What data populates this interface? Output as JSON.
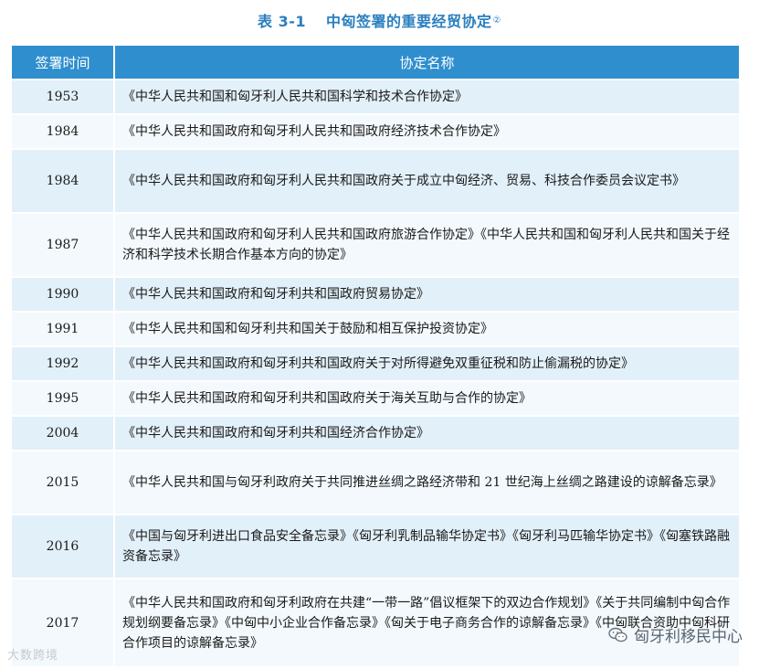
{
  "caption": {
    "number": "表 3-1",
    "title": "中匈签署的重要经贸协定",
    "footnote": "②"
  },
  "table": {
    "headers": [
      "签署时间",
      "协定名称"
    ],
    "rows": [
      {
        "year": "1953",
        "text": "《中华人民共和国和匈牙利人民共和国科学和技术合作协定》"
      },
      {
        "year": "1984",
        "text": "《中华人民共和国政府和匈牙利人民共和国政府经济技术合作协定》"
      },
      {
        "year": "1984",
        "text": "《中华人民共和国政府和匈牙利人民共和国政府关于成立中匈经济、贸易、科技合作委员会议定书》"
      },
      {
        "year": "1987",
        "text": "《中华人民共和国政府和匈牙利人民共和国政府旅游合作协定》《中华人民共和国和匈牙利人民共和国关于经济和科学技术长期合作基本方向的协定》"
      },
      {
        "year": "1990",
        "text": "《中华人民共和国政府和匈牙利共和国政府贸易协定》"
      },
      {
        "year": "1991",
        "text": "《中华人民共和国和匈牙利共和国关于鼓励和相互保护投资协定》"
      },
      {
        "year": "1992",
        "text": "《中华人民共和国政府和匈牙利共和国政府关于对所得避免双重征税和防止偷漏税的协定》"
      },
      {
        "year": "1995",
        "text": "《中华人民共和国政府和匈牙利共和国政府关于海关互助与合作的协定》"
      },
      {
        "year": "2004",
        "text": "《中华人民共和国政府和匈牙利共和国经济合作协定》"
      },
      {
        "year": "2015",
        "text": "《中华人民共和国与匈牙利政府关于共同推进丝绸之路经济带和 21 世纪海上丝绸之路建设的谅解备忘录》"
      },
      {
        "year": "2016",
        "text": "《中国与匈牙利进出口食品安全备忘录》《匈牙利乳制品输华协定书》《匈牙利马匹输华协定书》《匈塞铁路融资备忘录》"
      },
      {
        "year": "2017",
        "text": "《中华人民共和国政府和匈牙利政府在共建“一带一路”倡议框架下的双边合作规划》《关于共同编制中匈合作规划纲要备忘录》《中匈中小企业合作备忘录》《匈关于电子商务合作的谅解备忘录》《中匈联合资助中匈科研合作项目的谅解备忘录》"
      }
    ]
  },
  "watermarks": {
    "left": "大数跨境",
    "right": "匈牙利移民中心"
  }
}
